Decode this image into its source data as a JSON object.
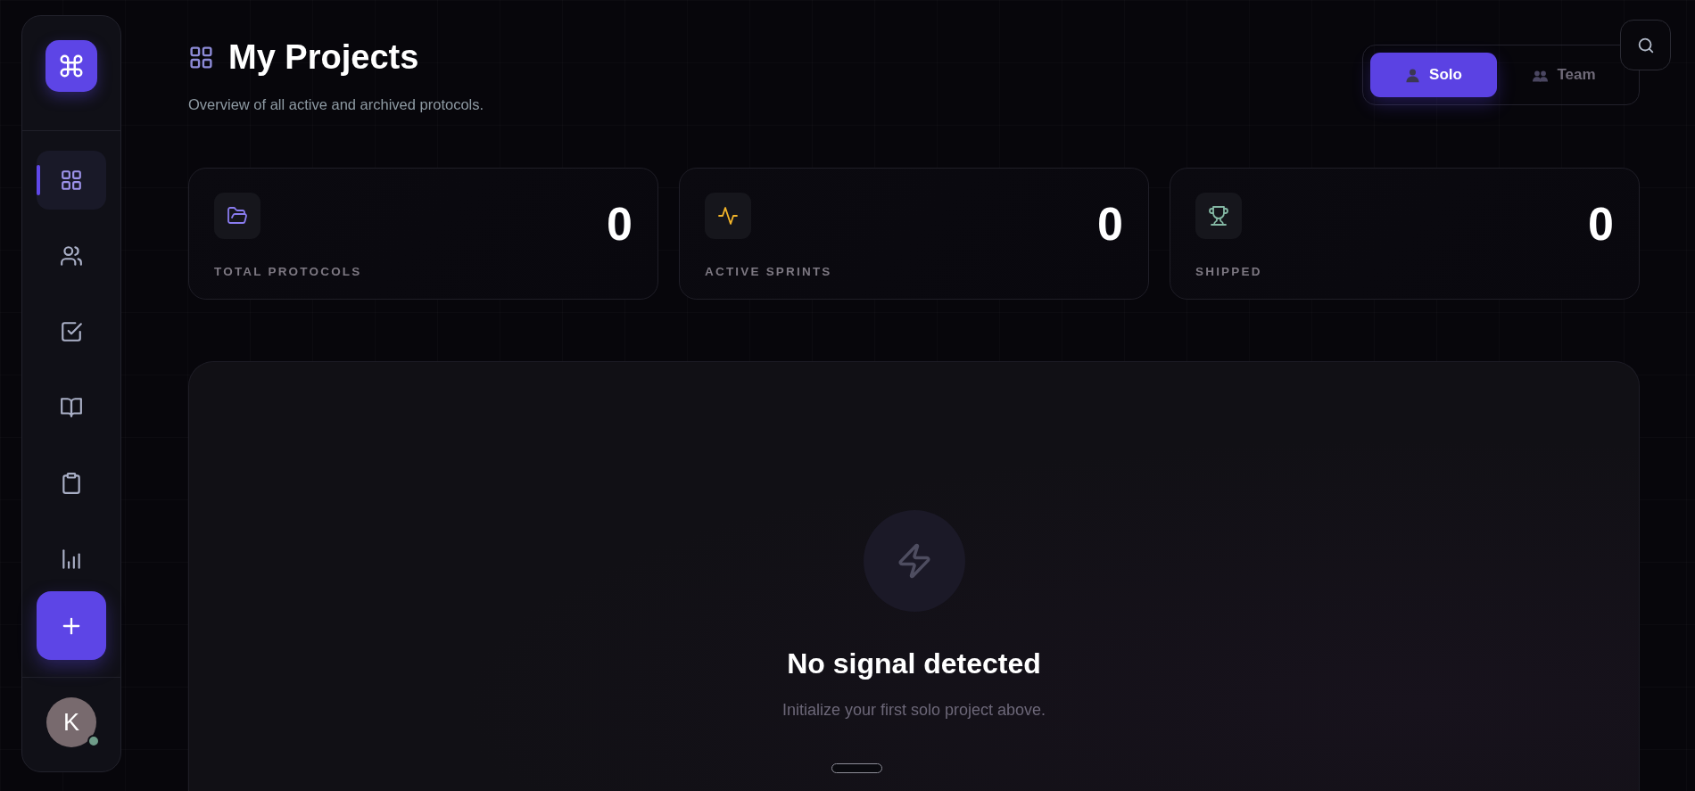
{
  "sidebar": {
    "items": [
      {
        "selected": true
      },
      {
        "selected": false
      },
      {
        "selected": false
      },
      {
        "selected": false
      },
      {
        "selected": false
      },
      {
        "selected": false
      }
    ],
    "avatar": {
      "initial": "K",
      "online": true
    }
  },
  "header": {
    "title": "My Projects",
    "subtitle": "Overview of all active and archived protocols."
  },
  "mode_toggle": [
    {
      "label": "Solo",
      "selected": true
    },
    {
      "label": "Team",
      "selected": false
    }
  ],
  "stats": [
    {
      "label": "TOTAL PROTOCOLS",
      "value": "0"
    },
    {
      "label": "ACTIVE SPRINTS",
      "value": "0"
    },
    {
      "label": "SHIPPED",
      "value": "0"
    }
  ],
  "empty_state": {
    "title": "No signal detected",
    "message": "Initialize your first solo project above."
  }
}
